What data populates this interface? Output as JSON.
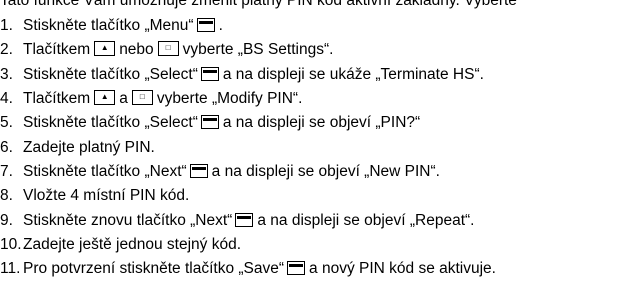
{
  "top_line": "Tato funkce Vám umožňuje změnit platný PIN kód aktivní základny. Vyberte",
  "steps": [
    {
      "num": "1.",
      "parts": [
        "Stiskněte tlačítko „Menu“ ",
        "."
      ]
    },
    {
      "num": "2.",
      "parts": [
        "Tlačítkem ",
        " nebo ",
        " vyberte „BS Settings“."
      ]
    },
    {
      "num": "3.",
      "parts": [
        "Stiskněte tlačítko „Select“ ",
        " a na displeji se ukáže „Terminate HS“."
      ]
    },
    {
      "num": "4.",
      "parts": [
        "Tlačítkem ",
        " a ",
        " vyberte „Modify PIN“."
      ]
    },
    {
      "num": "5.",
      "parts": [
        "Stiskněte tlačítko „Select“ ",
        " a na displeji se objeví „PIN?“"
      ]
    },
    {
      "num": "6.",
      "parts": [
        "Zadejte platný PIN."
      ]
    },
    {
      "num": "7.",
      "parts": [
        "Stiskněte tlačítko „Next“ ",
        " a na displeji se objeví „New PIN“."
      ]
    },
    {
      "num": "8.",
      "parts": [
        "Vložte 4 místní PIN kód."
      ]
    },
    {
      "num": "9.",
      "parts": [
        "Stiskněte znovu tlačítko „Next“ ",
        " a na displeji se objeví „Repeat“."
      ]
    },
    {
      "num": "10.",
      "parts": [
        "Zadejte ještě jednou stejný kód."
      ]
    },
    {
      "num": "11.",
      "parts": [
        "Pro potvrzení stiskněte tlačítko „Save“ ",
        " a nový PIN kód se aktivuje."
      ]
    }
  ],
  "icons": {
    "softkey": "softkey-icon",
    "up": "nav-up-icon",
    "down": "nav-down-icon"
  }
}
